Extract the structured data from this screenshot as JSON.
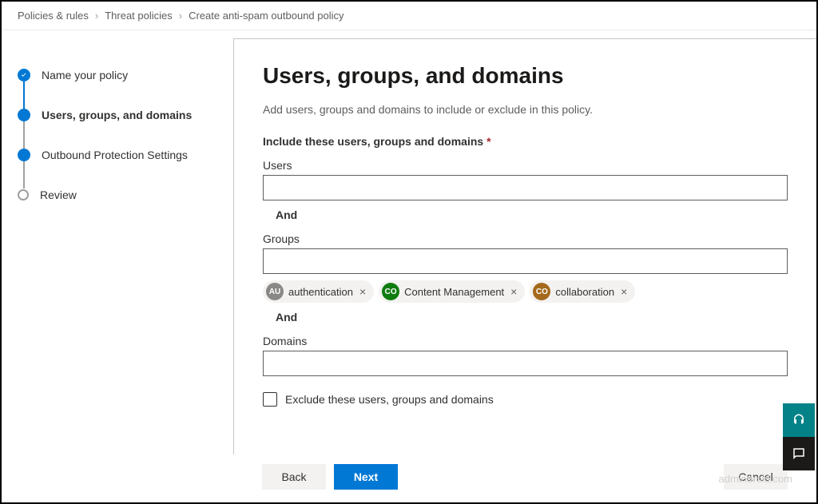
{
  "breadcrumb": {
    "items": [
      "Policies & rules",
      "Threat policies",
      "Create anti-spam outbound policy"
    ]
  },
  "steps": [
    {
      "label": "Name your policy",
      "state": "done"
    },
    {
      "label": "Users, groups, and domains",
      "state": "current"
    },
    {
      "label": "Outbound Protection Settings",
      "state": "upcoming-filled"
    },
    {
      "label": "Review",
      "state": "upcoming-empty"
    }
  ],
  "main": {
    "title": "Users, groups, and domains",
    "description": "Add users, groups and domains to include or exclude in this policy.",
    "include_label": "Include these users, groups and domains",
    "required_marker": "*",
    "users_label": "Users",
    "users_value": "",
    "and_label": "And",
    "groups_label": "Groups",
    "groups_value": "",
    "group_chips": [
      {
        "initials": "AU",
        "name": "authentication",
        "color": "#8a8886"
      },
      {
        "initials": "CO",
        "name": "Content Management",
        "color": "#107c10"
      },
      {
        "initials": "CO",
        "name": "collaboration",
        "color": "#a4691c"
      }
    ],
    "domains_label": "Domains",
    "domains_value": "",
    "exclude_label": "Exclude these users, groups and domains"
  },
  "footer": {
    "back": "Back",
    "next": "Next",
    "cancel": "Cancel"
  },
  "watermark": "admindroid.com"
}
